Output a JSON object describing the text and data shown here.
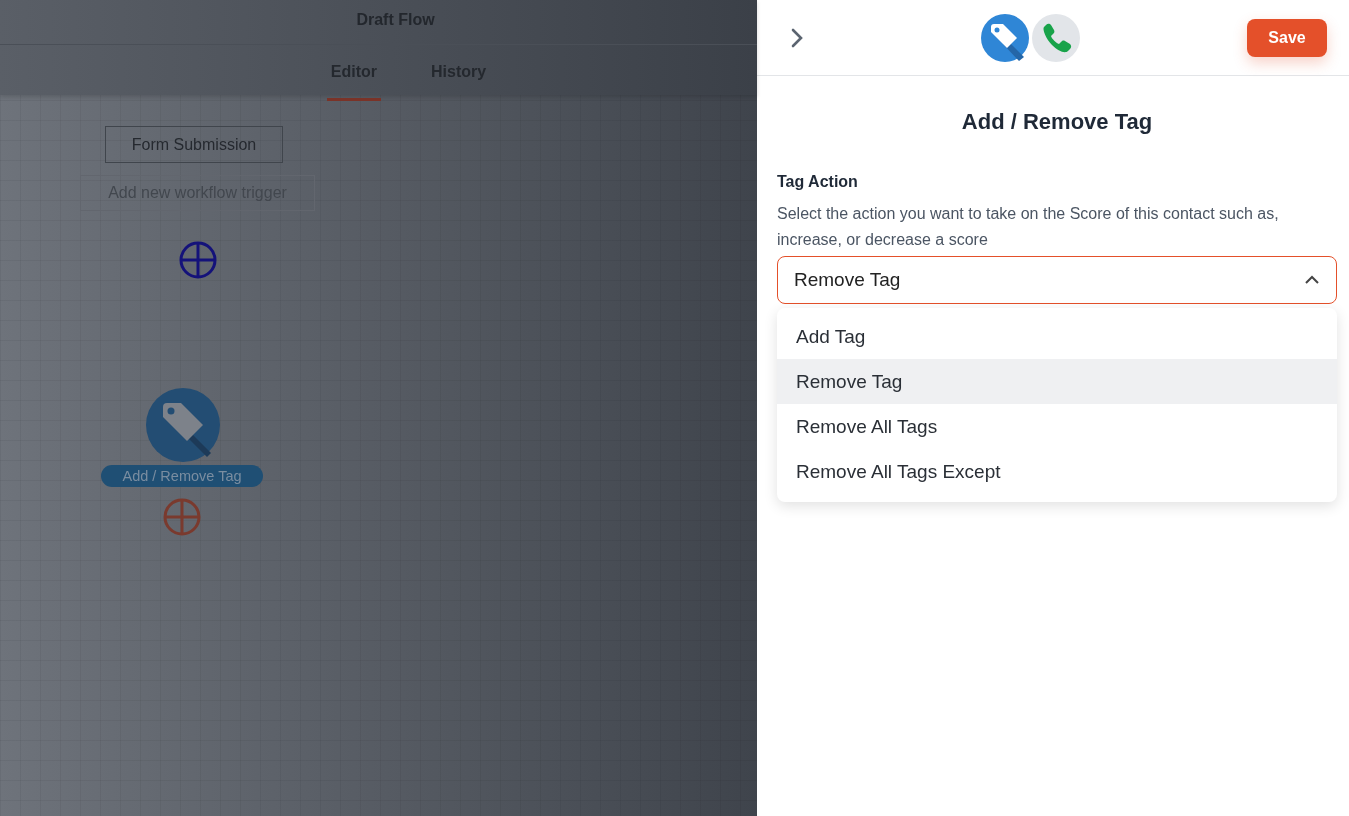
{
  "flow": {
    "title": "Draft Flow",
    "tabs": [
      {
        "label": "Editor",
        "selected": true
      },
      {
        "label": "History",
        "selected": false
      }
    ]
  },
  "canvas": {
    "trigger": "Form Submission",
    "add_trigger": "Add new workflow trigger",
    "action_node": {
      "label": "Add / Remove Tag"
    }
  },
  "panel": {
    "save_button": "Save",
    "title": "Add / Remove Tag",
    "field": {
      "label": "Tag Action",
      "description": "Select the action you want to take on the Score of this contact such as, increase, or decrease a score",
      "value": "Remove Tag",
      "expanded": true,
      "options": [
        {
          "label": "Add Tag",
          "selected": false
        },
        {
          "label": "Remove Tag",
          "selected": true
        },
        {
          "label": "Remove All Tags",
          "selected": false
        },
        {
          "label": "Remove All Tags Except",
          "selected": false
        }
      ]
    }
  }
}
